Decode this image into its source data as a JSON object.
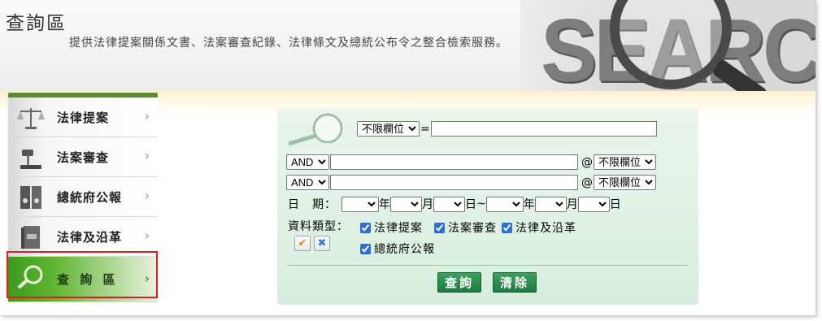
{
  "header": {
    "title": "查詢區",
    "subtitle": "提供法律提案關係文書、法案審查紀錄、法律條文及總統公布令之整合檢索服務。",
    "banner_text": "SEARCH"
  },
  "sidebar": {
    "items": [
      {
        "label": "法律提案",
        "icon": "scale-icon"
      },
      {
        "label": "法案審查",
        "icon": "gavel-icon"
      },
      {
        "label": "總統府公報",
        "icon": "binders-icon"
      },
      {
        "label": "法律及沿革",
        "icon": "law-book-icon"
      },
      {
        "label": "查 詢 區",
        "icon": "magnifier-icon"
      }
    ],
    "arrow": "›"
  },
  "search": {
    "field_default": "不限欄位",
    "equals": "=",
    "operator": "AND",
    "at": "@",
    "date_label": "日　期：",
    "year": "年",
    "month": "月",
    "day": "日",
    "tilde": "~",
    "type_label": "資料類型：",
    "types": [
      "法律提案",
      "法案審查",
      "法律及沿革",
      "總統府公報"
    ],
    "select_all_icon": "check-icon",
    "clear_all_icon": "x-icon"
  },
  "buttons": {
    "search": "查詢",
    "clear": "清除"
  },
  "colors": {
    "accent_green": "#3d9a1d",
    "panel_bg": "#dff1e4",
    "highlight_red": "#e01c24"
  }
}
